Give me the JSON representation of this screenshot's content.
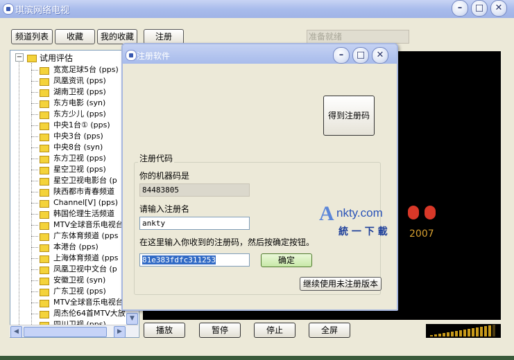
{
  "main_window": {
    "title": "琪滨网络电视",
    "toolbar": [
      "频道列表",
      "收藏",
      "我的收藏",
      "注册"
    ],
    "status_text": "准备就绪",
    "playback_buttons": [
      "播放",
      "暂停",
      "停止",
      "全屏"
    ],
    "volume_level": 0.9
  },
  "tree": {
    "root_label": "试用评估",
    "channels": [
      "宽宽足球5台 (pps)",
      "凤凰资讯 (pps)",
      "湖南卫视 (pps)",
      "东方电影 (syn)",
      "东方少儿 (pps)",
      "中央1台① (pps)",
      "中央3台 (pps)",
      "中央8台 (syn)",
      "东方卫视 (pps)",
      "星空卫视 (pps)",
      "星空卫视电影台 (p",
      "陕西都市青春频道",
      "Channel[V] (pps)",
      "韩国伦理生活频道",
      "MTV全球音乐电视台",
      "广东体育频道 (pps",
      "本港台 (pps)",
      "上海体育频道 (pps",
      "凤凰卫视中文台 (p",
      "安徽卫视 (syn)",
      "广东卫视 (pps)",
      "MTV全球音乐电视台",
      "周杰伦64首MTV大放",
      "四川卫视 (pps)"
    ]
  },
  "dialog": {
    "title": "注册软件",
    "get_code_button": "得到注册码",
    "group_label": "注册代码",
    "machine_code_label": "你的机器码是",
    "machine_code_value": "84483805",
    "name_label": "请输入注册名",
    "name_value": "ankty",
    "instruction": "在这里输入你收到的注册码，然后按确定按钮。",
    "code_value": "81e383fdfc311253",
    "ok_button": "确定",
    "continue_button": "继续使用未注册版本"
  },
  "watermark": {
    "brand": "Ankty.com",
    "slogan": "統 一 下 載",
    "year": "2007"
  },
  "colors": {
    "title_bar": "#a9bcec",
    "video_bg": "#000000",
    "selection": "#316ac5",
    "ok_button": "#d6f0b8"
  }
}
